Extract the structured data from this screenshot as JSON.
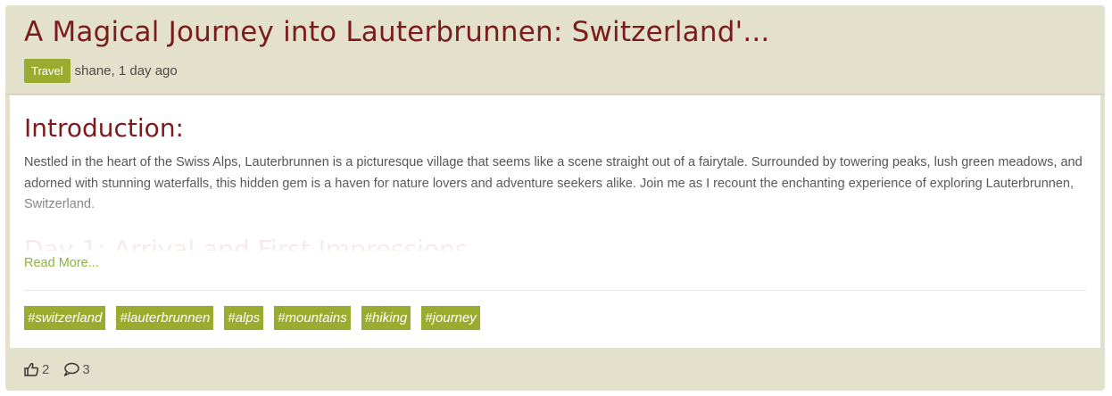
{
  "post": {
    "title": "A Magical Journey into Lauterbrunnen: Switzerland'...",
    "category": "Travel",
    "byline": "shane, 1 day ago"
  },
  "content": {
    "intro_heading": "Introduction:",
    "excerpt": "Nestled in the heart of the Swiss Alps, Lauterbrunnen is a picturesque village that seems like a scene straight out of a fairytale. Surrounded by towering peaks, lush green meadows, and adorned with stunning waterfalls, this hidden gem is a haven for nature lovers and adventure seekers alike. Join me as I recount the enchanting experience of exploring Lauterbrunnen, Switzerland.",
    "next_heading": "Day 1: Arrival and First Impressions",
    "read_more": "Read More..."
  },
  "tags": [
    "#switzerland",
    "#lauterbrunnen",
    "#alps",
    "#mountains",
    "#hiking",
    "#journey"
  ],
  "footer": {
    "likes": "2",
    "comments": "3",
    "like_icon": "thumbs-up-icon",
    "comment_icon": "comment-icon"
  },
  "colors": {
    "card_background": "#e3e1cb",
    "title": "#7b1c1c",
    "accent_green": "#9aac30",
    "link_green": "#8eb33b"
  }
}
